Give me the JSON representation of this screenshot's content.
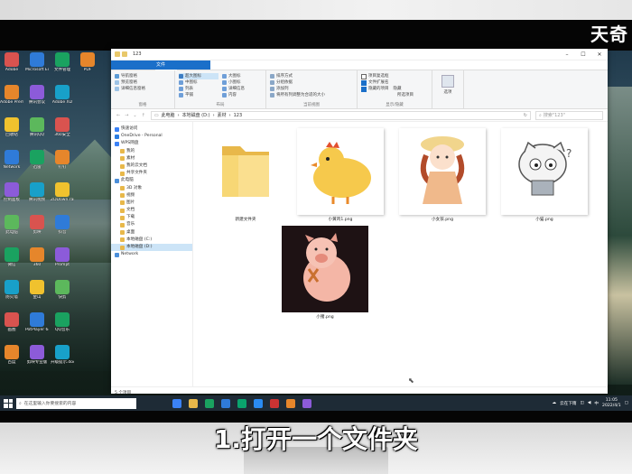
{
  "brand": "天奇",
  "caption": "1.打开一个文件夹",
  "window": {
    "title": "123",
    "tabs": [
      "文件",
      "主页",
      "共享",
      "查看"
    ],
    "ribbon": {
      "g1": {
        "r1": "导航窗格",
        "r2": "预览窗格",
        "r3": "详细信息窗格",
        "name": "窗格"
      },
      "g2": {
        "r1": "超大图标",
        "r2": "大图标",
        "r3": "中图标",
        "r4": "小图标",
        "r5": "列表",
        "r6": "详细信息",
        "r7": "平铺",
        "r8": "内容",
        "name": "布局"
      },
      "g3": {
        "r1": "排序方式",
        "r2": "分组依据",
        "r3": "添加列",
        "r4": "将所有列调整为合适的大小",
        "name": "当前视图"
      },
      "g4": {
        "r1": "项目复选框",
        "r2": "文件扩展名",
        "r3": "隐藏的项目",
        "r4": "隐藏",
        "r5": "所选项目",
        "name": "显示/隐藏"
      },
      "g5": {
        "r1": "选项"
      }
    },
    "address": {
      "path": [
        "此电脑",
        "本地磁盘 (D:)",
        "素材",
        "123"
      ],
      "search_placeholder": "搜索\"123\""
    },
    "nav": [
      {
        "label": "快速访问",
        "sel": false
      },
      {
        "label": "OneDrive - Personal",
        "sel": false
      },
      {
        "label": "WPS网盘",
        "sel": false
      },
      {
        "label": "我的",
        "sel": false
      },
      {
        "label": "素材",
        "sel": false
      },
      {
        "label": "我的云文档",
        "sel": false
      },
      {
        "label": "共享文件夹",
        "sel": false
      },
      {
        "label": "此电脑",
        "sel": false
      },
      {
        "label": "3D 对象",
        "sel": false
      },
      {
        "label": "视频",
        "sel": false
      },
      {
        "label": "图片",
        "sel": false
      },
      {
        "label": "文档",
        "sel": false
      },
      {
        "label": "下载",
        "sel": false
      },
      {
        "label": "音乐",
        "sel": false
      },
      {
        "label": "桌面",
        "sel": false
      },
      {
        "label": "本地磁盘 (C:)",
        "sel": false
      },
      {
        "label": "本地磁盘 (D:)",
        "sel": true
      },
      {
        "label": "Network",
        "sel": false
      }
    ],
    "files": [
      "新建文件夹",
      "小黄鸡1.png",
      "小女孩.png",
      "小猫.png",
      "小猪.png"
    ],
    "status": "5 个项目"
  },
  "desktop_icons": [
    [
      "Adobe",
      "Microsoft Edge",
      "文件管理",
      "PDF"
    ],
    [
      "Adobe Premiere",
      "腾讯会议",
      "Adobe XD",
      ""
    ],
    [
      "回收站",
      "腾讯QQ",
      "360安全",
      ""
    ],
    [
      "Network",
      "迅雷",
      "钉钉",
      ""
    ],
    [
      "控制面板",
      "腾讯视频",
      "ZDDown.rar",
      ""
    ],
    [
      "此电脑",
      "剪映",
      "抖音",
      ""
    ],
    [
      "微信",
      "360",
      "Prompt",
      ""
    ],
    [
      "防火墙",
      "金山",
      "快剪",
      ""
    ],
    [
      "画图",
      "PotPlayer 64",
      "QQ音乐",
      ""
    ],
    [
      "百度",
      "剪映专业版",
      "升级提示.docx",
      ""
    ]
  ],
  "taskbar": {
    "search_placeholder": "在这里输入你要搜索的内容",
    "weather": "云在下雨",
    "time": "11:05",
    "date": "2022/4/1",
    "lang": "中"
  },
  "colors": {
    "accent": "#1a6fc9",
    "taskbar": "#1e2b36"
  }
}
